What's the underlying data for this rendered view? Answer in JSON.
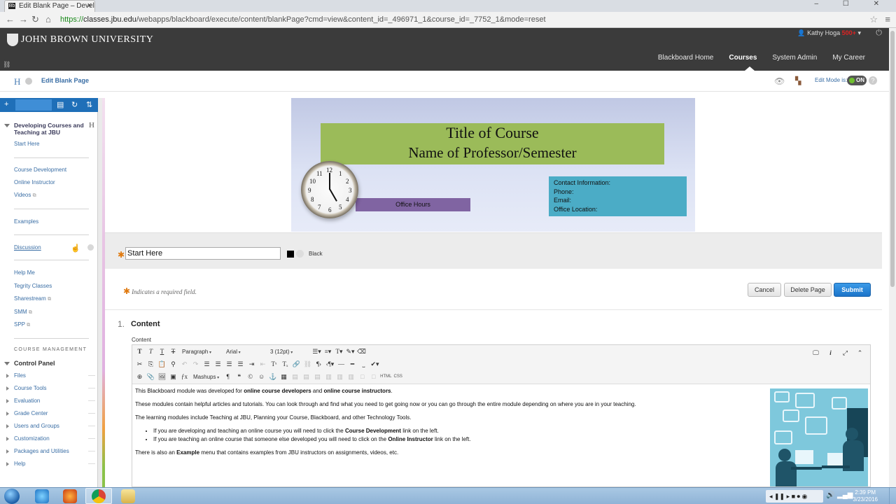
{
  "browser": {
    "tab_title": "Edit Blank Page – Develo",
    "tab_favicon": "Bb",
    "url_scheme": "https://",
    "url_host": "classes.jbu.edu",
    "url_path": "/webapps/blackboard/execute/content/blankPage?cmd=view&content_id=_496971_1&course_id=_7752_1&mode=reset",
    "window_controls": "–  ☐  ✕"
  },
  "header": {
    "institution": "JOHN BROWN UNIVERSITY",
    "user_name": "Kathy Hoga",
    "user_badge": "500+",
    "nav": [
      "Blackboard Home",
      "Courses",
      "System Admin",
      "My Career"
    ],
    "active_nav": "Courses"
  },
  "breadcrumb": {
    "home_glyph": "H",
    "page_title": "Edit Blank Page",
    "edit_mode_label": "Edit Mode is:",
    "edit_mode_value": "ON",
    "help_glyph": "?"
  },
  "sidebar": {
    "course_title": "Developing Courses and Teaching at JBU",
    "course_glyph": "H",
    "links": [
      "Start Here",
      "Course Development",
      "Online Instructor",
      "Videos",
      "Examples",
      "Discussion",
      "Help Me",
      "Tegrity Classes",
      "Sharestream",
      "SMM",
      "SPP"
    ],
    "course_management_label": "COURSE MANAGEMENT",
    "control_panel_label": "Control Panel",
    "control_panel_items": [
      "Files",
      "Course Tools",
      "Evaluation",
      "Grade Center",
      "Users and Groups",
      "Customization",
      "Packages and Utilities",
      "Help"
    ]
  },
  "banner": {
    "title_line1": "Title of Course",
    "title_line2": "Name of Professor/Semester",
    "office_hours": "Office Hours",
    "contact_lines": [
      "Contact Information:",
      "Phone:",
      "Email:",
      "Office Location:"
    ],
    "clock_numbers": [
      "12",
      "1",
      "2",
      "3",
      "4",
      "5",
      "6",
      "7",
      "8",
      "9",
      "10",
      "11"
    ]
  },
  "form": {
    "name_value": "Start Here",
    "color_name": "Black",
    "color_hex": "#000000",
    "required_note": "Indicates a required field.",
    "cancel_label": "Cancel",
    "delete_label": "Delete Page",
    "submit_label": "Submit",
    "section_number": "1.",
    "section_title": "Content",
    "field_label": "Content"
  },
  "editor": {
    "paragraph_format": "Paragraph",
    "font_family": "Arial",
    "font_size": "3 (12pt)",
    "mashups_label": "Mashups",
    "html_label": "HTML",
    "css_label": "CSS",
    "content": {
      "p1_a": "This Blackboard module was developed for ",
      "p1_b": "online course developers",
      "p1_c": " and ",
      "p1_d": "online course instructors",
      "p1_e": ".",
      "p2": "These modules contain  helpful articles and tutorials.  You can look through and find what you need to get going now or you can go through the entire module depending on where you are in your teaching.",
      "p3": "The learning modules include Teaching at JBU, Planning your Course, Blackboard, and other Technology Tools.",
      "li1_a": "If you are developing and teaching an online course you will need to click the ",
      "li1_b": "Course Development",
      "li1_c": " link on the left.",
      "li2_a": "If you are teaching an online course that someone else developed you will need to click on the ",
      "li2_b": "Online Instructor",
      "li2_c": " link on the left.",
      "p4_a": "There is also an ",
      "p4_b": "Example",
      "p4_c": " menu that contains examples from JBU instructors on assignments, videos, etc."
    }
  },
  "taskbar": {
    "time": "2:39 PM",
    "date": "3/23/2016"
  },
  "colors": {
    "bb_header": "#3b3b3b",
    "link_blue": "#3a6ea5",
    "submit_blue": "#1b74c9",
    "banner_green": "#9bbb59",
    "banner_purple": "#8064a2",
    "banner_teal": "#4bacc6",
    "required_orange": "#e07a10"
  }
}
